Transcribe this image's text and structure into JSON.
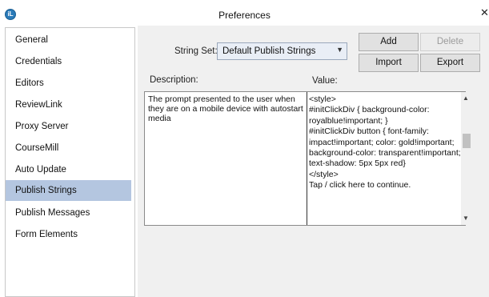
{
  "window": {
    "title": "Preferences",
    "logo_text": "iL",
    "close_glyph": "✕"
  },
  "sidebar": {
    "items": [
      {
        "label": "General"
      },
      {
        "label": "Credentials"
      },
      {
        "label": "Editors"
      },
      {
        "label": "ReviewLink"
      },
      {
        "label": "Proxy Server"
      },
      {
        "label": "CourseMill"
      },
      {
        "label": "Auto Update"
      },
      {
        "label": "Publish Strings",
        "selected": true
      },
      {
        "label": "Publish Messages"
      },
      {
        "label": "Form Elements"
      }
    ]
  },
  "string_set": {
    "label": "String Set:",
    "selected": "Default Publish Strings"
  },
  "buttons": {
    "add": "Add",
    "delete": "Delete",
    "import": "Import",
    "export": "Export"
  },
  "table": {
    "description_header": "Description:",
    "value_header": "Value:",
    "description_text": "The prompt presented to the user when they are on a mobile device with autostart media",
    "value_lines": [
      "<style>",
      "#initClickDiv { background-color: royalblue!important; }",
      "#initClickDiv button { font-family: impact!important; color: gold!important; background-color: transparent!important; text-shadow: 5px 5px red}",
      "</style>",
      "Tap / click here to continue."
    ]
  },
  "colors": {
    "selected_item": "#b4c6e0",
    "panel_bg": "#f0f0f0",
    "combo_bg": "#e9eef6"
  }
}
